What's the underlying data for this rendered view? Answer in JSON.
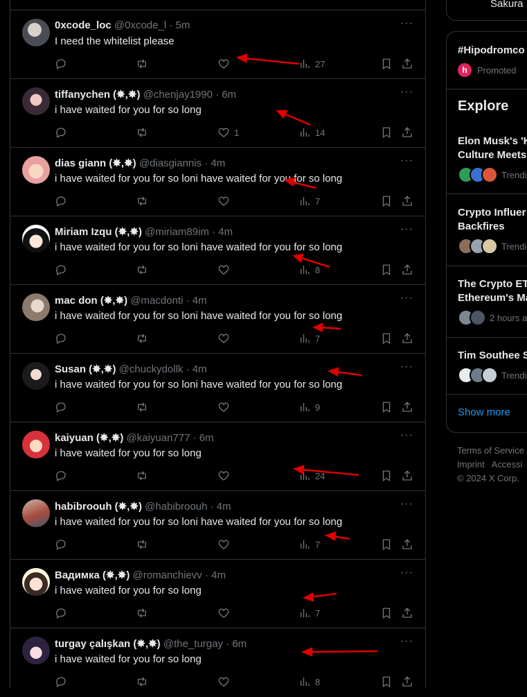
{
  "feed": {
    "tweets": [
      {
        "name": "0xcode_loc",
        "handle": "@0xcode_l",
        "time": "· 5m",
        "text": "I need the whitelist please",
        "likes": "",
        "views": "27"
      },
      {
        "name": "tiffanychen (✸,✸)",
        "handle": "@chenjay1990",
        "time": "· 6m",
        "text": "i have waited for you for so long",
        "likes": "1",
        "views": "14"
      },
      {
        "name": "dias giann (✸,✸)",
        "handle": "@diasgiannis",
        "time": "· 4m",
        "text": "i have waited for you for so loni have waited for you for so long",
        "likes": "",
        "views": "7"
      },
      {
        "name": "Miriam Izqu (✸,✸)",
        "handle": "@miriam89im",
        "time": "· 4m",
        "text": "i have waited for you for so loni have waited for you for so long",
        "likes": "",
        "views": "8"
      },
      {
        "name": "mac don (✸,✸)",
        "handle": "@macdonti",
        "time": "· 4m",
        "text": "i have waited for you for so loni have waited for you for so long",
        "likes": "",
        "views": "7"
      },
      {
        "name": "Susan (✸,✸)",
        "handle": "@chuckydollk",
        "time": "· 4m",
        "text": "i have waited for you for so loni have waited for you for so long",
        "likes": "",
        "views": "9"
      },
      {
        "name": "kaiyuan (✸,✸)",
        "handle": "@kaiyuan777",
        "time": "· 6m",
        "text": "i have waited for you for so long",
        "likes": "",
        "views": "24"
      },
      {
        "name": "habibroouh (✸,✸)",
        "handle": "@habibroouh",
        "time": "· 4m",
        "text": "i have waited for you for so loni have waited for you for so long",
        "likes": "",
        "views": "7"
      },
      {
        "name": "Вадимка (✸,✸)",
        "handle": "@romanchievv",
        "time": "· 4m",
        "text": "i have waited for you for so long",
        "likes": "",
        "views": "7"
      },
      {
        "name": "turgay çalışkan (✸,✸)",
        "handle": "@the_turgay",
        "time": "· 6m",
        "text": "i have waited for you for so long",
        "likes": "",
        "views": "8"
      }
    ],
    "more_label": "···"
  },
  "sidebar": {
    "top_card_text": "Sakura",
    "promoted_title": "#Hipodromco",
    "promoted_label": "Promoted",
    "promoted_logo": "h",
    "explore_title": "Explore",
    "trends": [
      {
        "title_line1": "Elon Musk's 'K",
        "title_line2": "Culture Meets",
        "meta": "Trendin"
      },
      {
        "title_line1": "Crypto Influer",
        "title_line2": "Backfires",
        "meta": "Trendin"
      },
      {
        "title_line1": "The Crypto ET",
        "title_line2": "Ethereum's Ma",
        "meta": "2 hours a"
      },
      {
        "title_line1": "Tim Southee S",
        "title_line2": "",
        "meta": "Trendin"
      }
    ],
    "show_more": "Show more"
  },
  "footer": {
    "line1_a": "Terms of Service",
    "line2_a": "Imprint",
    "line2_b": "Accessi",
    "line3": "© 2024 X Corp."
  },
  "colors": {
    "accent": "#1d9bf0",
    "muted": "#71767b",
    "text": "#e7e9ea",
    "border": "#2f3336",
    "annotation_arrow": "#e00000"
  }
}
